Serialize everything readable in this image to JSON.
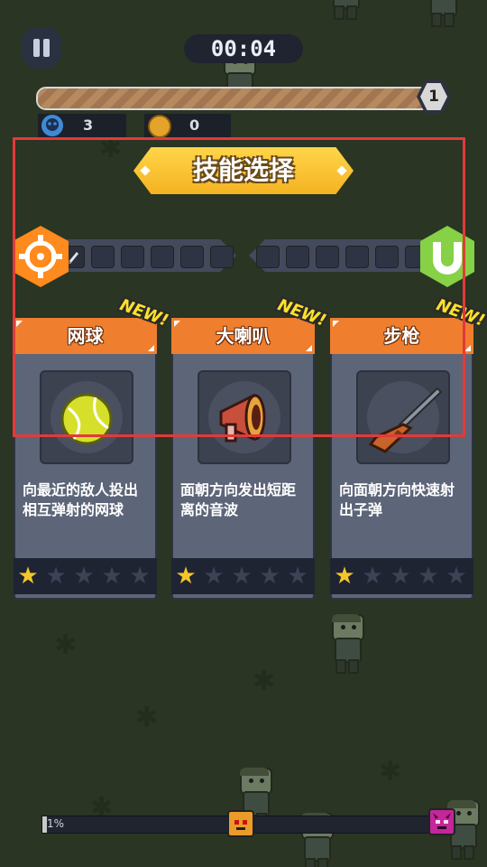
{
  "hud": {
    "timer": "00:04",
    "level": "1",
    "kills": "3",
    "coins": "0",
    "experience_fraction": 0.98
  },
  "panel": {
    "title": "技能选择"
  },
  "cards": [
    {
      "name": "网球",
      "badge": "NEW!",
      "description": "向最近的敌人投出相互弹射的网球",
      "stars_filled": 1,
      "stars_total": 5
    },
    {
      "name": "大喇叭",
      "badge": "NEW!",
      "description": "面朝方向发出短距离的音波",
      "stars_filled": 1,
      "stars_total": 5
    },
    {
      "name": "步枪",
      "badge": "NEW!",
      "description": "向面朝方向快速射出子弹",
      "stars_filled": 1,
      "stars_total": 5
    }
  ],
  "wave": {
    "progress_label": "1%",
    "progress_fraction": 0.01
  },
  "colors": {
    "card_header": "#ef7e2e",
    "banner": "#f4b321",
    "star_on": "#f3c62a",
    "highlight_frame": "#e23a3a"
  },
  "icons": {
    "pause": "pause-icon",
    "kills": "skull-icon",
    "coins": "coin-icon",
    "weapon_category": "crosshair-icon",
    "passive_category": "magnet-icon",
    "owned_weapon": "knife-icon",
    "cards": [
      "tennis-ball-icon",
      "megaphone-icon",
      "rifle-icon"
    ]
  }
}
